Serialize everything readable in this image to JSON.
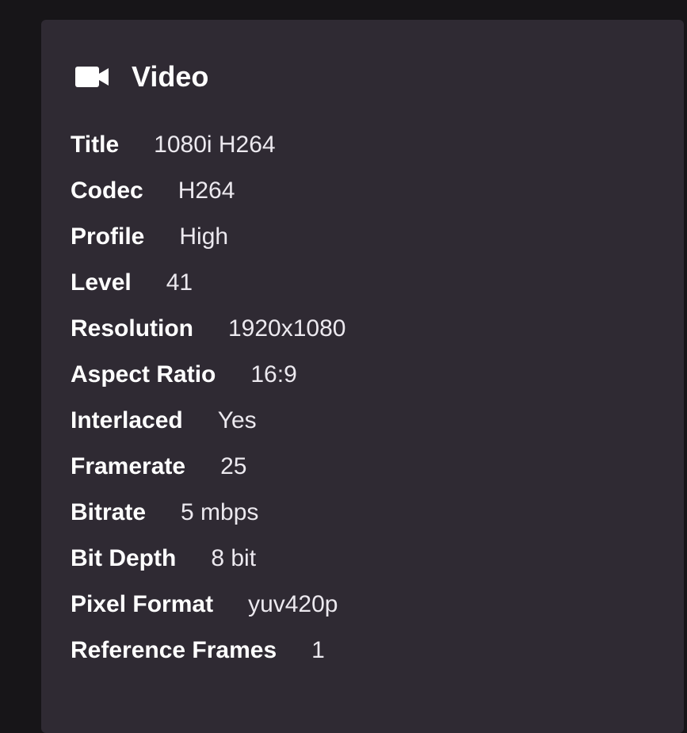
{
  "panel": {
    "icon": "video-camera-icon",
    "title": "Video",
    "rows": [
      {
        "label": "Title",
        "value": "1080i H264"
      },
      {
        "label": "Codec",
        "value": "H264"
      },
      {
        "label": "Profile",
        "value": "High"
      },
      {
        "label": "Level",
        "value": "41"
      },
      {
        "label": "Resolution",
        "value": "1920x1080"
      },
      {
        "label": "Aspect Ratio",
        "value": "16:9"
      },
      {
        "label": "Interlaced",
        "value": "Yes"
      },
      {
        "label": "Framerate",
        "value": "25"
      },
      {
        "label": "Bitrate",
        "value": "5 mbps"
      },
      {
        "label": "Bit Depth",
        "value": "8 bit"
      },
      {
        "label": "Pixel Format",
        "value": "yuv420p"
      },
      {
        "label": "Reference Frames",
        "value": "1"
      }
    ]
  },
  "colors": {
    "page_background": "#171518",
    "card_background": "#2f2a33",
    "text": "#ffffff"
  }
}
